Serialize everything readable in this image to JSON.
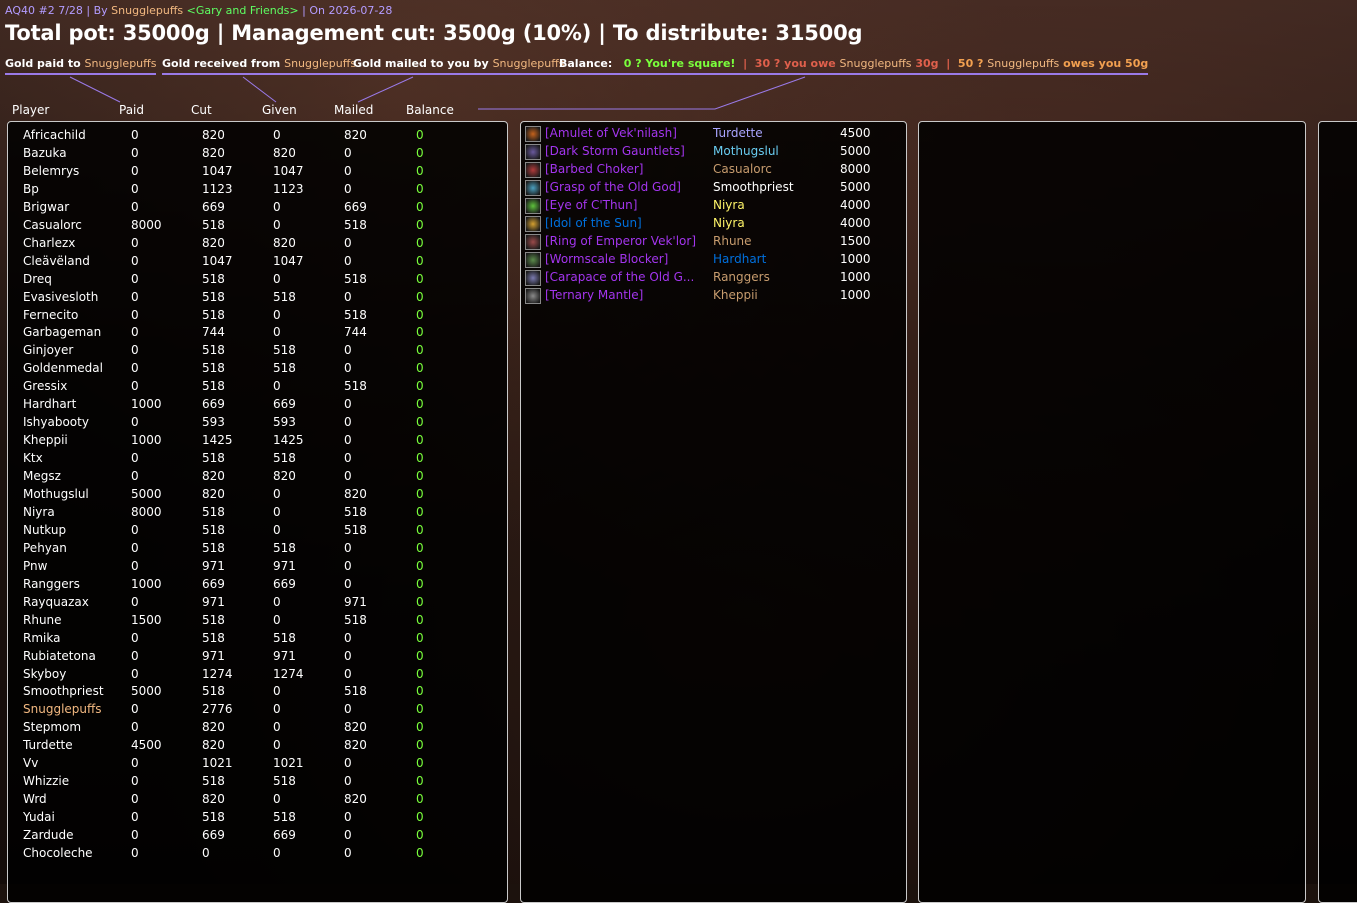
{
  "header": {
    "raid": "AQ40 #2 7/28",
    "by_sep": " | By ",
    "author": "Snugglepuffs",
    "guild": "<Gary and Friends>",
    "date_text": " | On 2026-07-28"
  },
  "summary": "Total pot: 35000g | Management cut: 3500g (10%) | To distribute: 31500g",
  "legends": {
    "paid": {
      "label": "Gold paid to ",
      "name": "Snugglepuffs"
    },
    "received": {
      "label": "Gold received from ",
      "name": "Snugglepuffs"
    },
    "mailed": {
      "label": "Gold mailed to you by ",
      "name": "Snugglepuffs"
    },
    "balance": {
      "label": "Balance:",
      "square": "0 ? You're square!",
      "sep1": "|",
      "owe_a": "30 ? you owe ",
      "owe_name": "Snugglepuffs",
      "owe_b": " 30g",
      "sep2": "|",
      "owes_a": "50 ? ",
      "owes_name": "Snugglepuffs",
      "owes_b": " owes you 50g"
    }
  },
  "columns": {
    "player": "Player",
    "paid": "Paid",
    "cut": "Cut",
    "given": "Given",
    "mailed": "Mailed",
    "balance": "Balance"
  },
  "colors": {
    "snugglepuffs": "#f2b880",
    "balance_ok": "#7aff3c",
    "epic": "#a335ee",
    "rare": "#0070dd",
    "accent": "#9a7ae8"
  },
  "players": [
    {
      "name": "Africachild",
      "paid": "0",
      "cut": "820",
      "given": "0",
      "mailed": "820",
      "balance": "0"
    },
    {
      "name": "Bazuka",
      "paid": "0",
      "cut": "820",
      "given": "820",
      "mailed": "0",
      "balance": "0"
    },
    {
      "name": "Belemrys",
      "paid": "0",
      "cut": "1047",
      "given": "1047",
      "mailed": "0",
      "balance": "0"
    },
    {
      "name": "Bp",
      "paid": "0",
      "cut": "1123",
      "given": "1123",
      "mailed": "0",
      "balance": "0"
    },
    {
      "name": "Brigwar",
      "paid": "0",
      "cut": "669",
      "given": "0",
      "mailed": "669",
      "balance": "0"
    },
    {
      "name": "Casualorc",
      "paid": "8000",
      "cut": "518",
      "given": "0",
      "mailed": "518",
      "balance": "0"
    },
    {
      "name": "Charlezx",
      "paid": "0",
      "cut": "820",
      "given": "820",
      "mailed": "0",
      "balance": "0"
    },
    {
      "name": "Cleävëland",
      "paid": "0",
      "cut": "1047",
      "given": "1047",
      "mailed": "0",
      "balance": "0"
    },
    {
      "name": "Dreq",
      "paid": "0",
      "cut": "518",
      "given": "0",
      "mailed": "518",
      "balance": "0"
    },
    {
      "name": "Evasivesloth",
      "paid": "0",
      "cut": "518",
      "given": "518",
      "mailed": "0",
      "balance": "0"
    },
    {
      "name": "Fernecito",
      "paid": "0",
      "cut": "518",
      "given": "0",
      "mailed": "518",
      "balance": "0"
    },
    {
      "name": "Garbageman",
      "paid": "0",
      "cut": "744",
      "given": "0",
      "mailed": "744",
      "balance": "0"
    },
    {
      "name": "Ginjoyer",
      "paid": "0",
      "cut": "518",
      "given": "518",
      "mailed": "0",
      "balance": "0"
    },
    {
      "name": "Goldenmedal",
      "paid": "0",
      "cut": "518",
      "given": "518",
      "mailed": "0",
      "balance": "0"
    },
    {
      "name": "Gressix",
      "paid": "0",
      "cut": "518",
      "given": "0",
      "mailed": "518",
      "balance": "0"
    },
    {
      "name": "Hardhart",
      "paid": "1000",
      "cut": "669",
      "given": "669",
      "mailed": "0",
      "balance": "0"
    },
    {
      "name": "Ishyabooty",
      "paid": "0",
      "cut": "593",
      "given": "593",
      "mailed": "0",
      "balance": "0"
    },
    {
      "name": "Kheppii",
      "paid": "1000",
      "cut": "1425",
      "given": "1425",
      "mailed": "0",
      "balance": "0"
    },
    {
      "name": "Ktx",
      "paid": "0",
      "cut": "518",
      "given": "518",
      "mailed": "0",
      "balance": "0"
    },
    {
      "name": "Megsz",
      "paid": "0",
      "cut": "820",
      "given": "820",
      "mailed": "0",
      "balance": "0"
    },
    {
      "name": "Mothugslul",
      "paid": "5000",
      "cut": "820",
      "given": "0",
      "mailed": "820",
      "balance": "0"
    },
    {
      "name": "Niyra",
      "paid": "8000",
      "cut": "518",
      "given": "0",
      "mailed": "518",
      "balance": "0"
    },
    {
      "name": "Nutkup",
      "paid": "0",
      "cut": "518",
      "given": "0",
      "mailed": "518",
      "balance": "0"
    },
    {
      "name": "Pehyan",
      "paid": "0",
      "cut": "518",
      "given": "518",
      "mailed": "0",
      "balance": "0"
    },
    {
      "name": "Pnw",
      "paid": "0",
      "cut": "971",
      "given": "971",
      "mailed": "0",
      "balance": "0"
    },
    {
      "name": "Ranggers",
      "paid": "1000",
      "cut": "669",
      "given": "669",
      "mailed": "0",
      "balance": "0"
    },
    {
      "name": "Rayquazax",
      "paid": "0",
      "cut": "971",
      "given": "0",
      "mailed": "971",
      "balance": "0"
    },
    {
      "name": "Rhune",
      "paid": "1500",
      "cut": "518",
      "given": "0",
      "mailed": "518",
      "balance": "0"
    },
    {
      "name": "Rmika",
      "paid": "0",
      "cut": "518",
      "given": "518",
      "mailed": "0",
      "balance": "0"
    },
    {
      "name": "Rubiatetona",
      "paid": "0",
      "cut": "971",
      "given": "971",
      "mailed": "0",
      "balance": "0"
    },
    {
      "name": "Skyboy",
      "paid": "0",
      "cut": "1274",
      "given": "1274",
      "mailed": "0",
      "balance": "0"
    },
    {
      "name": "Smoothpriest",
      "paid": "5000",
      "cut": "518",
      "given": "0",
      "mailed": "518",
      "balance": "0"
    },
    {
      "name": "Snugglepuffs",
      "paid": "0",
      "cut": "2776",
      "given": "0",
      "mailed": "0",
      "balance": "0",
      "color": "#f2b880"
    },
    {
      "name": "Stepmom",
      "paid": "0",
      "cut": "820",
      "given": "0",
      "mailed": "820",
      "balance": "0"
    },
    {
      "name": "Turdette",
      "paid": "4500",
      "cut": "820",
      "given": "0",
      "mailed": "820",
      "balance": "0"
    },
    {
      "name": "Vv",
      "paid": "0",
      "cut": "1021",
      "given": "1021",
      "mailed": "0",
      "balance": "0"
    },
    {
      "name": "Whizzie",
      "paid": "0",
      "cut": "518",
      "given": "518",
      "mailed": "0",
      "balance": "0"
    },
    {
      "name": "Wrd",
      "paid": "0",
      "cut": "820",
      "given": "0",
      "mailed": "820",
      "balance": "0"
    },
    {
      "name": "Yudai",
      "paid": "0",
      "cut": "518",
      "given": "518",
      "mailed": "0",
      "balance": "0"
    },
    {
      "name": "Zardude",
      "paid": "0",
      "cut": "669",
      "given": "669",
      "mailed": "0",
      "balance": "0"
    },
    {
      "name": "Chocoleche",
      "paid": "0",
      "cut": "0",
      "given": "0",
      "mailed": "0",
      "balance": "0"
    }
  ],
  "items": [
    {
      "name": "[Amulet of Vek'nilash]",
      "winner": "Turdette",
      "winner_color": "#a9a5ff",
      "price": "4500",
      "icon": "amulet-icon",
      "icon_color": "#c4621c",
      "quality_color": "#a335ee"
    },
    {
      "name": "[Dark Storm Gauntlets]",
      "winner": "Mothugslul",
      "winner_color": "#69ccf0",
      "price": "5000",
      "icon": "gauntlets-icon",
      "icon_color": "#6a5a9e",
      "quality_color": "#a335ee"
    },
    {
      "name": "[Barbed Choker]",
      "winner": "Casualorc",
      "winner_color": "#c79c6e",
      "price": "8000",
      "icon": "choker-icon",
      "icon_color": "#b03a3a",
      "quality_color": "#a335ee"
    },
    {
      "name": "[Grasp of the Old God]",
      "winner": "Smoothpriest",
      "winner_color": "#ffffff",
      "price": "5000",
      "icon": "grasp-icon",
      "icon_color": "#4aa0c0",
      "quality_color": "#a335ee"
    },
    {
      "name": "[Eye of C'Thun]",
      "winner": "Niyra",
      "winner_color": "#fff569",
      "price": "4000",
      "icon": "eye-icon",
      "icon_color": "#5ec23c",
      "quality_color": "#a335ee"
    },
    {
      "name": "[Idol of the Sun]",
      "winner": "Niyra",
      "winner_color": "#fff569",
      "price": "4000",
      "icon": "idol-icon",
      "icon_color": "#d4a030",
      "quality_color": "#0070dd"
    },
    {
      "name": "[Ring of Emperor Vek'lor]",
      "winner": "Rhune",
      "winner_color": "#c79c6e",
      "price": "1500",
      "icon": "ring-icon",
      "icon_color": "#9a4a4a",
      "quality_color": "#a335ee"
    },
    {
      "name": "[Wormscale Blocker]",
      "winner": "Hardhart",
      "winner_color": "#0070de",
      "price": "1000",
      "icon": "shield-icon",
      "icon_color": "#5a8a4a",
      "quality_color": "#a335ee"
    },
    {
      "name": "[Carapace of the Old G...",
      "winner": "Ranggers",
      "winner_color": "#c79c6e",
      "price": "1000",
      "icon": "carapace-icon",
      "icon_color": "#7a7ab0",
      "quality_color": "#a335ee"
    },
    {
      "name": "[Ternary Mantle]",
      "winner": "Kheppii",
      "winner_color": "#c79c6e",
      "price": "1000",
      "icon": "mantle-icon",
      "icon_color": "#8a8a8a",
      "quality_color": "#a335ee"
    }
  ]
}
